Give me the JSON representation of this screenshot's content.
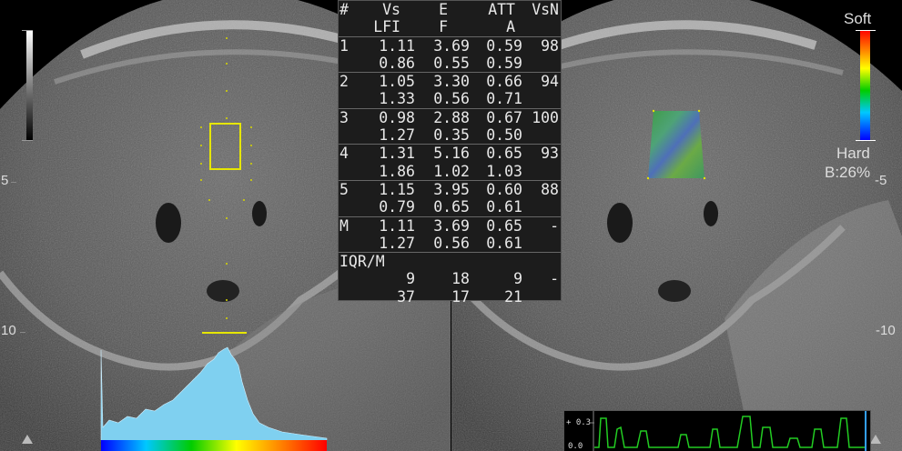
{
  "table": {
    "header": [
      [
        "#",
        "Vs",
        "E",
        "ATT",
        "VsN"
      ],
      [
        "",
        "LFI",
        "F",
        "A",
        ""
      ]
    ],
    "rows": [
      [
        [
          "1",
          "1.11",
          "3.69",
          "0.59",
          "98"
        ],
        [
          "",
          "0.86",
          "0.55",
          "0.59",
          ""
        ]
      ],
      [
        [
          "2",
          "1.05",
          "3.30",
          "0.66",
          "94"
        ],
        [
          "",
          "1.33",
          "0.56",
          "0.71",
          ""
        ]
      ],
      [
        [
          "3",
          "0.98",
          "2.88",
          "0.67",
          "100"
        ],
        [
          "",
          "1.27",
          "0.35",
          "0.50",
          ""
        ]
      ],
      [
        [
          "4",
          "1.31",
          "5.16",
          "0.65",
          "93"
        ],
        [
          "",
          "1.86",
          "1.02",
          "1.03",
          ""
        ]
      ],
      [
        [
          "5",
          "1.15",
          "3.95",
          "0.60",
          "88"
        ],
        [
          "",
          "0.79",
          "0.65",
          "0.61",
          ""
        ]
      ],
      [
        [
          "M",
          "1.11",
          "3.69",
          "0.65",
          "-"
        ],
        [
          "",
          "1.27",
          "0.56",
          "0.61",
          ""
        ]
      ]
    ],
    "iqr_label": "IQR/M",
    "iqr": [
      [
        "",
        "9",
        "18",
        "9",
        "-"
      ],
      [
        "",
        "37",
        "17",
        "21",
        ""
      ]
    ]
  },
  "depth": {
    "left_5": "5",
    "left_10": "10",
    "right_5": "-5",
    "right_10": "-10"
  },
  "colorbar": {
    "top_label": "Soft",
    "bottom_label": "Hard",
    "b_label": "B:26%"
  },
  "trace": {
    "y_top_label": "+ 0.3",
    "y_bottom_label": "0.0"
  },
  "colors": {
    "roi": "#e6e600",
    "trace": "#22cc22",
    "histogram": "#7fd0f0",
    "cursor": "#33a0ff"
  }
}
